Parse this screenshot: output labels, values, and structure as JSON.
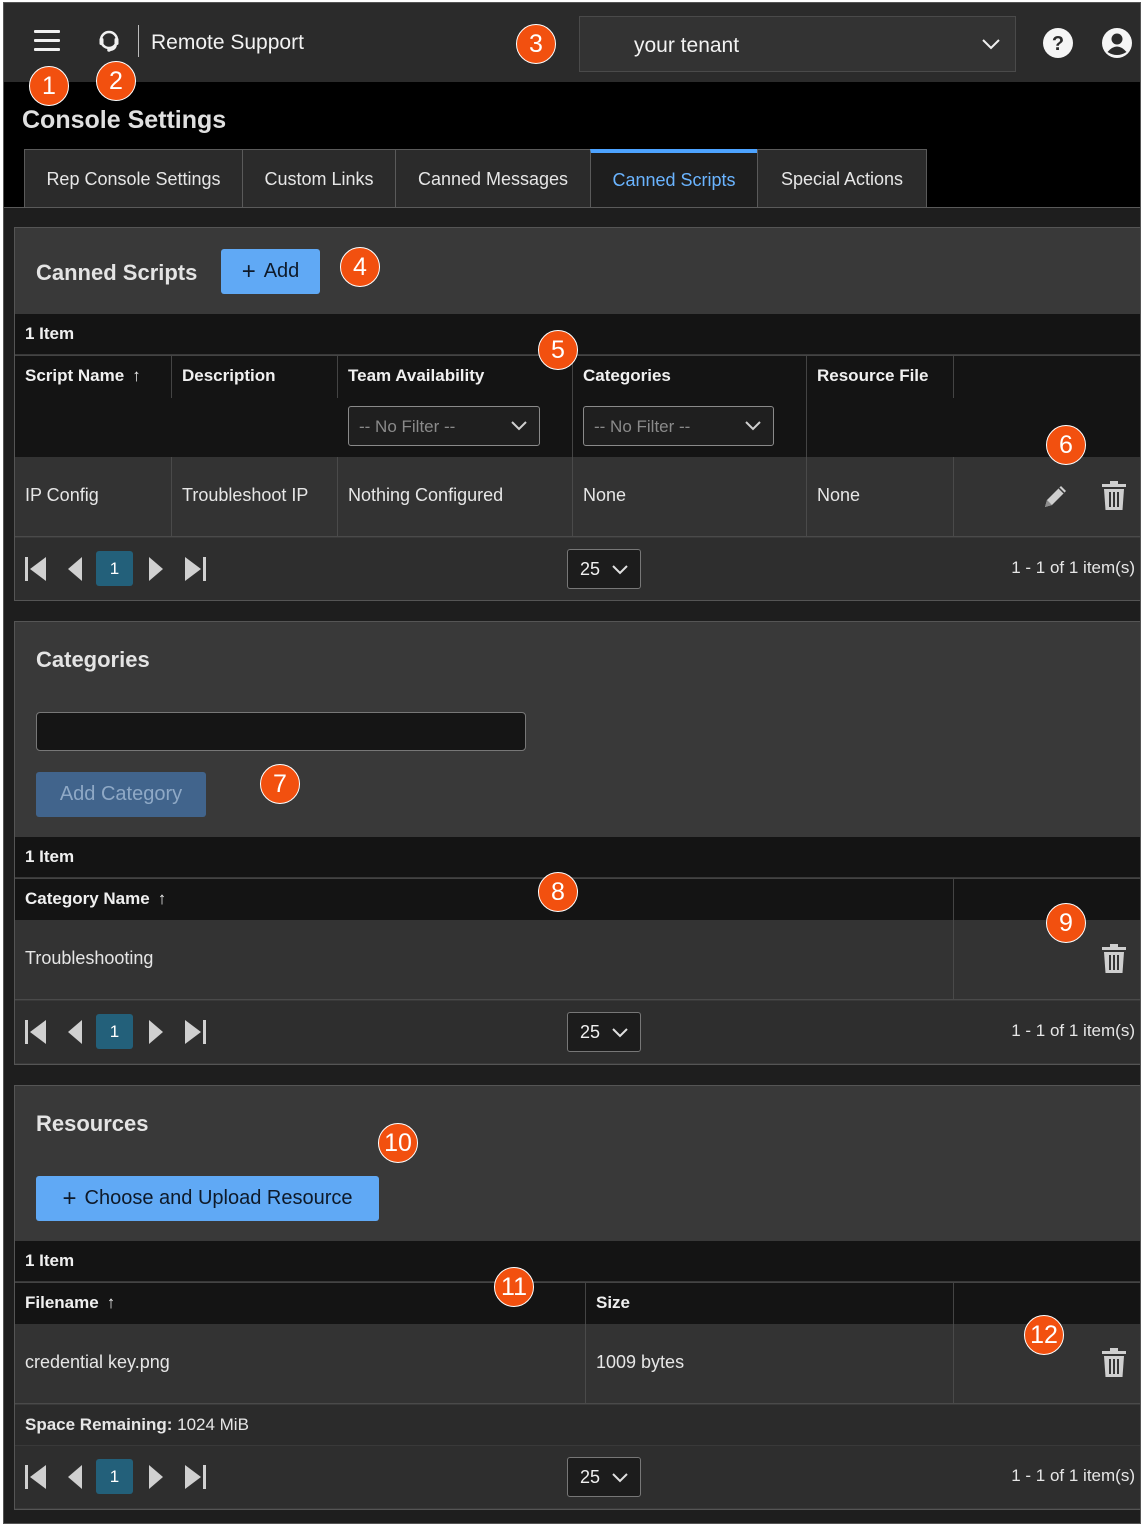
{
  "header": {
    "brand": "Remote Support",
    "tenant": "your tenant",
    "icons": {
      "menu": "hamburger-menu-icon",
      "logo": "headset-logo-icon",
      "help": "help-circle-icon",
      "user": "user-account-icon"
    }
  },
  "page_title": "Console Settings",
  "tabs": [
    {
      "label": "Rep Console Settings",
      "active": false
    },
    {
      "label": "Custom Links",
      "active": false
    },
    {
      "label": "Canned Messages",
      "active": false
    },
    {
      "label": "Canned Scripts",
      "active": true
    },
    {
      "label": "Special Actions",
      "active": false
    }
  ],
  "canned_scripts": {
    "title": "Canned Scripts",
    "add_label": "Add",
    "count": "1 Item",
    "columns": [
      "Script Name",
      "Description",
      "Team Availability",
      "Categories",
      "Resource File"
    ],
    "filter_placeholder": "-- No Filter --",
    "rows": [
      {
        "name": "IP Config",
        "description": "Troubleshoot IP",
        "team": "Nothing Configured",
        "categories": "None",
        "resource": "None"
      }
    ],
    "pager": {
      "page": "1",
      "size": "25",
      "info": "1 - 1 of 1 item(s)"
    }
  },
  "categories": {
    "title": "Categories",
    "input_value": "",
    "add_label": "Add Category",
    "count": "1 Item",
    "columns": [
      "Category Name"
    ],
    "rows": [
      {
        "name": "Troubleshooting"
      }
    ],
    "pager": {
      "page": "1",
      "size": "25",
      "info": "1 - 1 of 1 item(s)"
    }
  },
  "resources": {
    "title": "Resources",
    "upload_label": "Choose and Upload Resource",
    "count": "1 Item",
    "columns": [
      "Filename",
      "Size"
    ],
    "rows": [
      {
        "filename": "credential key.png",
        "size": "1009 bytes"
      }
    ],
    "space_label": "Space Remaining:",
    "space_value": "1024 MiB",
    "pager": {
      "page": "1",
      "size": "25",
      "info": "1 - 1 of 1 item(s)"
    }
  },
  "callouts": [
    "1",
    "2",
    "3",
    "4",
    "5",
    "6",
    "7",
    "8",
    "9",
    "10",
    "11",
    "12"
  ],
  "colors": {
    "accent": "#60a9f5",
    "callout": "#f2500f",
    "active_tab": "#4da3ff"
  }
}
